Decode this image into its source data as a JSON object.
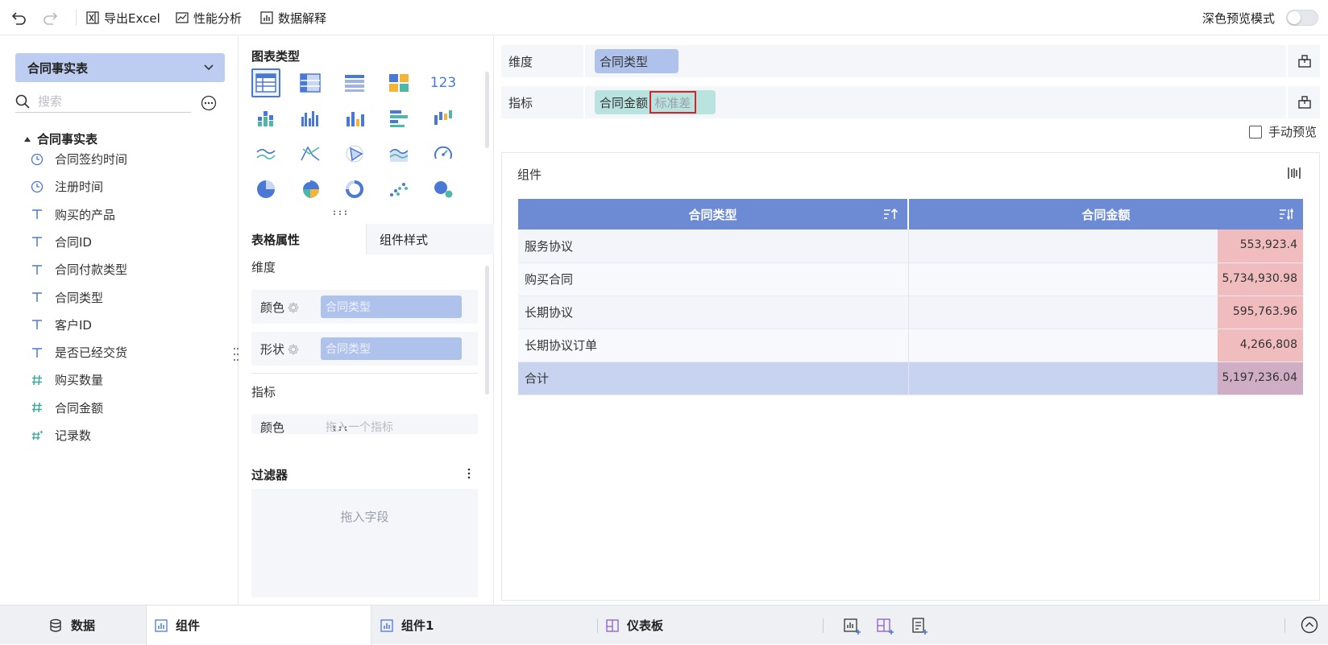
{
  "toolbar": {
    "undo_icon": "undo-icon",
    "redo_icon": "redo-icon",
    "export_label": "导出Excel",
    "perf_label": "性能分析",
    "explain_label": "数据解释",
    "dark_mode_label": "深色预览模式",
    "dark_mode_on": false
  },
  "data_panel": {
    "table_name": "合同事实表",
    "search_placeholder": "搜索",
    "tree_root": "合同事实表",
    "fields": [
      {
        "label": "合同签约时间",
        "type": "date"
      },
      {
        "label": "注册时间",
        "type": "date"
      },
      {
        "label": "购买的产品",
        "type": "text"
      },
      {
        "label": "合同ID",
        "type": "text"
      },
      {
        "label": "合同付款类型",
        "type": "text"
      },
      {
        "label": "合同类型",
        "type": "text"
      },
      {
        "label": "客户ID",
        "type": "text"
      },
      {
        "label": "是否已经交货",
        "type": "text"
      },
      {
        "label": "购买数量",
        "type": "number"
      },
      {
        "label": "合同金额",
        "type": "number"
      },
      {
        "label": "记录数",
        "type": "count"
      }
    ]
  },
  "config_panel": {
    "chart_types_title": "图表类型",
    "tab_table_props": "表格属性",
    "tab_component_style": "组件样式",
    "dimension_title": "维度",
    "color_label": "颜色",
    "color_value": "合同类型",
    "shape_label": "形状",
    "shape_value": "合同类型",
    "measure_title": "指标",
    "measure_color_label": "颜色",
    "measure_color_hint": "拖入一个指标",
    "filter_title": "过滤器",
    "filter_hint": "拖入字段"
  },
  "shelves": {
    "dimension_label": "维度",
    "dimension_chip": "合同类型",
    "measure_label": "指标",
    "measure_chip": "合同金额",
    "measure_agg": "标准差",
    "manual_preview_label": "手动预览"
  },
  "component": {
    "title": "组件",
    "columns": [
      "合同类型",
      "合同金额"
    ],
    "rows": [
      {
        "type": "服务协议",
        "amount": "553,923.4"
      },
      {
        "type": "购买合同",
        "amount": "5,734,930.98"
      },
      {
        "type": "长期协议",
        "amount": "595,763.96"
      },
      {
        "type": "长期协议订单",
        "amount": "4,266,808"
      }
    ],
    "total": {
      "label": "合计",
      "amount": "5,197,236.04"
    }
  },
  "bottom_tabs": {
    "data_label": "数据",
    "tab1_label": "组件",
    "tab2_label": "组件1",
    "dashboard_label": "仪表板"
  },
  "colors": {
    "accent": "#4a78d6",
    "header_blue": "#6d8ad4",
    "dimension_chip": "#aec2ec",
    "measure_chip": "#b9e3df",
    "highlight_red": "#d9212a"
  }
}
